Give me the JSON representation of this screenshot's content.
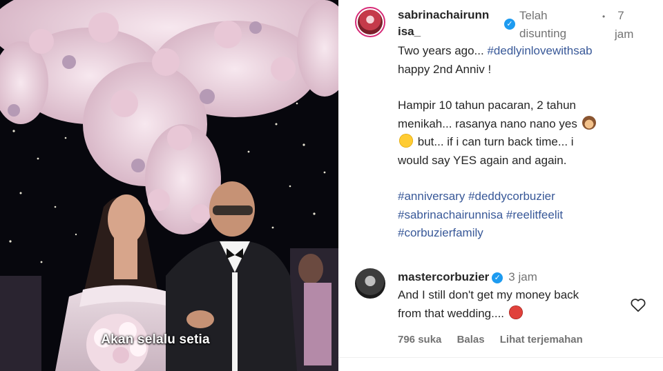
{
  "media": {
    "caption_overlay": "Akan selalu setia"
  },
  "post": {
    "author": "sabrinachairunnisa_",
    "author_line1": "sabrinachairunn",
    "author_line2": "isa_",
    "edited_label_line1": "Telah",
    "edited_label_line2": "disunting",
    "time_line1": "7",
    "time_line2": "jam",
    "caption": {
      "line1_text": "Two years ago... ",
      "line1_tag": "#dedlyinlovewithsab",
      "line2": "happy 2nd Anniv !",
      "line3": "Hampir 10 tahun pacaran, 2 tahun",
      "line4": "menikah... rasanya nano nano yes",
      "line5": "but... if i can turn back time... i",
      "line6": "would say YES again and again.",
      "hashtags": [
        "#anniversary",
        "#deddycorbuzier",
        "#sabrinachairunnisa",
        "#reelitfeelit",
        "#corbuzierfamily"
      ]
    }
  },
  "comment": {
    "author": "mastercorbuzier",
    "time": "3 jam",
    "text_line1": "And I still don't get my money back",
    "text_line2": "from that wedding...."
  },
  "actions": {
    "likes": "796 suka",
    "reply": "Balas",
    "translate": "Lihat terjemahan"
  },
  "icons": {
    "verified": "verified-badge-icon",
    "heart": "heart-outline-icon",
    "emoji1": "see-no-evil-monkey-emoji",
    "emoji2": "smiling-face-with-hearts-emoji",
    "emoji3": "angry-face-emoji"
  },
  "colors": {
    "hashtag": "#385898",
    "verified": "#1d9bf0",
    "muted": "#737373"
  }
}
